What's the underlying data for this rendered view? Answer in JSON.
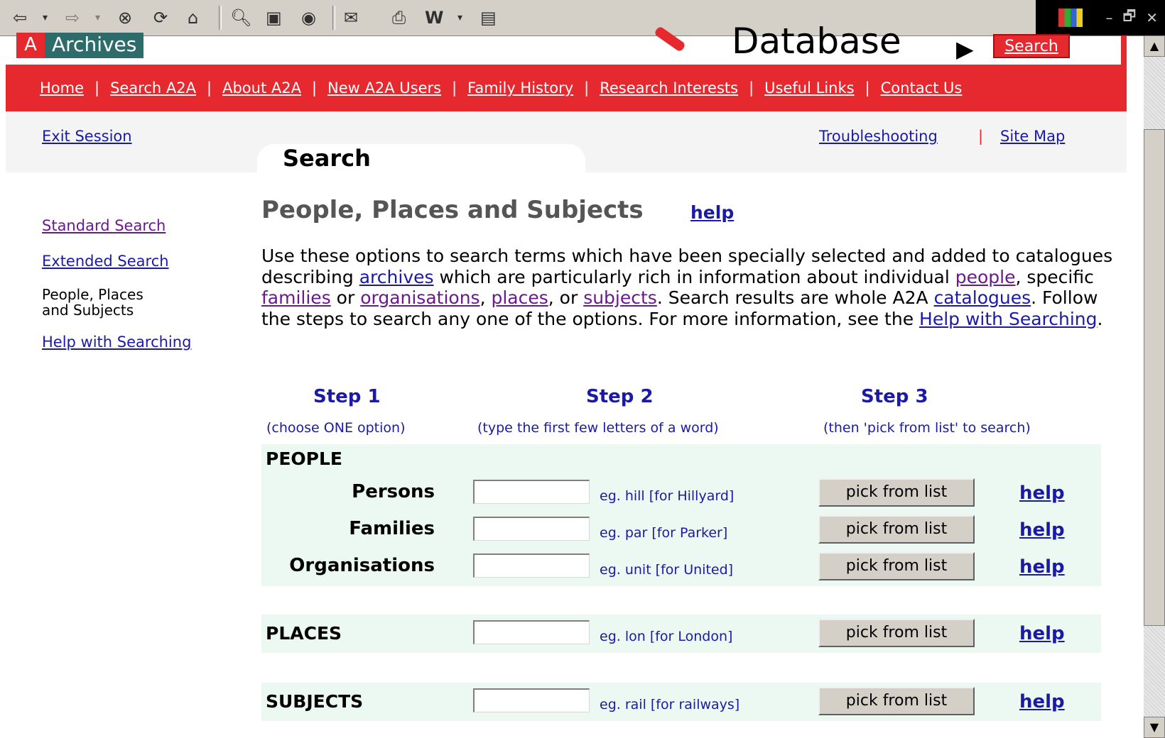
{
  "browser_toolbar": {
    "icons": [
      "back-icon",
      "back-dropdown-icon",
      "forward-icon",
      "forward-dropdown-icon",
      "stop-icon",
      "refresh-icon",
      "home-icon",
      "search-icon",
      "favorites-icon",
      "history-icon",
      "mail-icon",
      "print-icon",
      "word-icon",
      "word-dropdown-icon",
      "discuss-icon"
    ],
    "window_controls": [
      "–",
      "🗗",
      "✕"
    ]
  },
  "site": {
    "brand_letter": "A",
    "brand_name": "Archives",
    "title": "Database",
    "title_arrow": "▶",
    "search_link": "Search"
  },
  "nav": {
    "items": [
      "Home",
      "Search A2A",
      "About A2A",
      "New A2A Users",
      "Family History",
      "Research Interests",
      "Useful Links",
      "Contact Us"
    ],
    "separator": "|"
  },
  "utility": {
    "exit": "Exit Session",
    "troubleshooting": "Troubleshooting",
    "separator": "|",
    "site_map": "Site Map",
    "tab_title": "Search"
  },
  "leftnav": {
    "standard": "Standard Search",
    "extended": "Extended Search",
    "current_line1": "People, Places",
    "current_line2": "and Subjects",
    "help": "Help with Searching"
  },
  "main": {
    "heading": "People, Places and Subjects",
    "heading_help": "help",
    "intro": {
      "t1": "Use these options to search terms which have been specially selected and added to catalogues describing ",
      "l1": "archives",
      "t2": " which are particularly rich in information about individual ",
      "l2": "people",
      "t3": ", specific ",
      "l3": "families",
      "t4": " or ",
      "l4": "organisations",
      "t5": ", ",
      "l5": "places",
      "t6": ", or ",
      "l6": "subjects",
      "t7": ". Search results are whole A2A ",
      "l7": "catalogues",
      "t8": ". Follow the steps to search any one of the options. For more information, see the ",
      "l8": "Help with Searching",
      "t9": "."
    },
    "steps": [
      {
        "title": "Step 1",
        "sub": "(choose ONE option)"
      },
      {
        "title": "Step 2",
        "sub": "(type the first few letters of a word)"
      },
      {
        "title": "Step 3",
        "sub": "(then 'pick from list' to search)"
      }
    ],
    "people_label": "PEOPLE",
    "rows": [
      {
        "label": "Persons",
        "value": "",
        "example": "eg. hill  [for Hillyard]",
        "button": "pick from list",
        "help": "help"
      },
      {
        "label": "Families",
        "value": "",
        "example": "eg. par  [for Parker]",
        "button": "pick from list",
        "help": "help"
      },
      {
        "label": "Organisations",
        "value": "",
        "example": "eg. unit  [for United]",
        "button": "pick from list",
        "help": "help"
      },
      {
        "label": "PLACES",
        "value": "",
        "example": "eg. lon  [for London]",
        "button": "pick from list",
        "help": "help"
      },
      {
        "label": "SUBJECTS",
        "value": "",
        "example": "eg. rail  [for railways]",
        "button": "pick from list",
        "help": "help"
      }
    ]
  },
  "colors": {
    "brand_red": "#e6282f",
    "brand_teal": "#2e6b6b",
    "link_blue": "#1a1aa6",
    "visited_purple": "#6a1a8a",
    "band_green": "#ecf8f2"
  }
}
